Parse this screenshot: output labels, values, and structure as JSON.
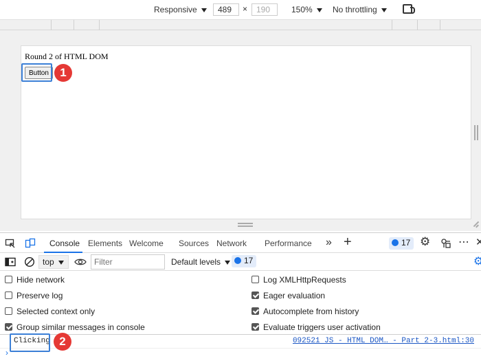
{
  "device_toolbar": {
    "device_mode": "Responsive",
    "width_value": "489",
    "times_sign": "×",
    "height_value": "190",
    "zoom": "150%",
    "throttling": "No throttling"
  },
  "page": {
    "heading": "Round 2 of HTML DOM",
    "button_label": "Button",
    "badge_1": "1"
  },
  "devtools_tabs": {
    "items": [
      "Console",
      "Elements",
      "Welcome",
      "Sources",
      "Network",
      "Performance"
    ],
    "active": "Console",
    "issues_count": "17"
  },
  "console_toolbar": {
    "context": "top",
    "filter_placeholder": "Filter",
    "levels": "Default levels",
    "issues_count": "17"
  },
  "settings": {
    "left": [
      {
        "label": "Hide network",
        "checked": false
      },
      {
        "label": "Preserve log",
        "checked": false
      },
      {
        "label": "Selected context only",
        "checked": false
      },
      {
        "label": "Group similar messages in console",
        "checked": true
      }
    ],
    "right": [
      {
        "label": "Log XMLHttpRequests",
        "checked": false
      },
      {
        "label": "Eager evaluation",
        "checked": true
      },
      {
        "label": "Autocomplete from history",
        "checked": true
      },
      {
        "label": "Evaluate triggers user activation",
        "checked": true
      }
    ]
  },
  "console": {
    "message": "Clicking",
    "source": "092521 JS - HTML DOM… - Part 2-3.html:30",
    "badge_2": "2",
    "prompt": "›"
  },
  "colors": {
    "accent": "#1a73e8",
    "highlight": "#3b7fd6",
    "badge": "#e53935"
  }
}
